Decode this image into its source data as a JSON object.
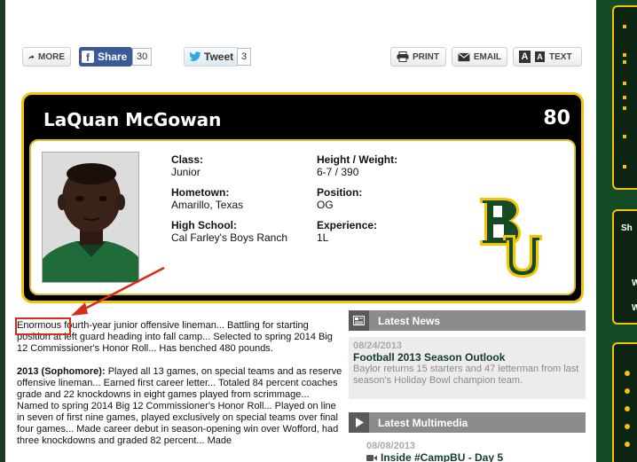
{
  "toolbar": {
    "more_label": "MORE",
    "share_label": "Share",
    "share_count": "30",
    "tweet_label": "Tweet",
    "tweet_count": "3",
    "print_label": "PRINT",
    "email_label": "EMAIL",
    "text_size_small": "A",
    "text_size_large": "A",
    "text_label": "TEXT"
  },
  "player": {
    "name": "LaQuan McGowan",
    "number": "80",
    "class_label": "Class:",
    "class_value": "Junior",
    "hometown_label": "Hometown:",
    "hometown_value": "Amarillo, Texas",
    "high_school_label": "High School:",
    "high_school_value": "Cal Farley's Boys Ranch",
    "height_weight_label": "Height / Weight:",
    "height_weight_value": "6-7 / 390",
    "position_label": "Position:",
    "position_value": "OG",
    "experience_label": "Experience:",
    "experience_value": "1L"
  },
  "bio": {
    "highlight_word": "Enormous",
    "intro_rest": " fourth-year junior offensive lineman... Battling for starting position at left guard heading into fall camp... Selected to spring 2014 Big 12 Commissioner's Honor Roll... Has benched 480 pounds.",
    "season_heading": "2013 (Sophomore):",
    "season_text": " Played all 13 games, on special teams and as reserve offensive lineman... Earned first career letter... Totaled 84 percent coaches grade and 22 knockdowns in eight games played from scrimmage... Named to spring 2014 Big 12 Commissioner's Honor Roll... Played on line in seven of first nine games, played exclusively on special teams over final four games... Made career debut in season-opening win over Wofford, had three knockdowns and graded 82 percent... Made"
  },
  "sidebar": {
    "latest_news_heading": "Latest News",
    "news": {
      "date": "08/24/2013",
      "title": "Football 2013 Season Outlook",
      "description": "Baylor returns 15 starters and 47 letterman from last season's Holiday Bowl champion team."
    },
    "latest_multimedia_heading": "Latest Multimedia",
    "multimedia": {
      "date": "08/08/2013",
      "title": "Inside #CampBU - Day 5"
    }
  },
  "right_rail": {
    "promo_letters": [
      "Sh",
      "W",
      "W"
    ]
  },
  "colors": {
    "baylor_green": "#154a26",
    "baylor_gold": "#f2c500",
    "annotation_red": "#d62c1a",
    "facebook_blue": "#3b5998"
  }
}
